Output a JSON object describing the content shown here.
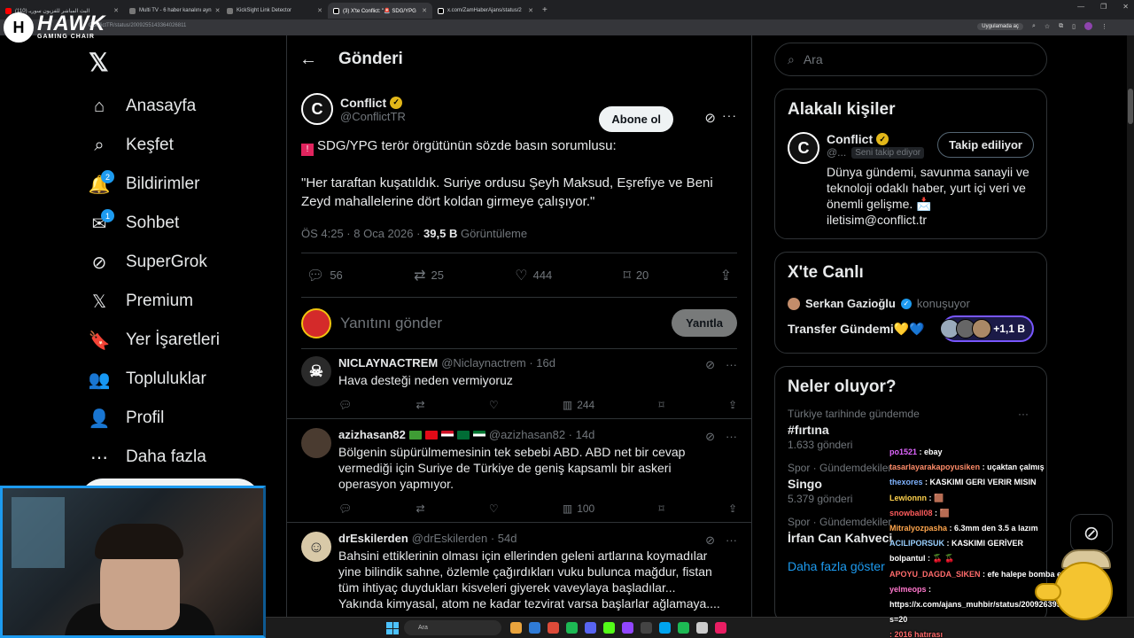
{
  "browser": {
    "tabs": [
      {
        "label": "(110) البث المباشر للفزيون سوريـ"
      },
      {
        "label": "Multi TV - 6 haber kanalını ayn"
      },
      {
        "label": "KickSight Link Detector"
      },
      {
        "label": "(3) X'te Conflict: \"🚨 SDG/YPG"
      },
      {
        "label": "x.com/ZamHaberAjans/status/2"
      }
    ],
    "url": "ConflictTR/status/2009255143364026811",
    "app_button": "Uygulamada aç"
  },
  "hawk": {
    "name": "HAWK",
    "sub": "GAMING CHAIR"
  },
  "nav": {
    "items": [
      {
        "label": "Anasayfa",
        "icon": "home-icon",
        "glyph": "⌂"
      },
      {
        "label": "Keşfet",
        "icon": "search-icon",
        "glyph": "⌕"
      },
      {
        "label": "Bildirimler",
        "icon": "bell-icon",
        "glyph": "🔔",
        "badge": "2"
      },
      {
        "label": "Sohbet",
        "icon": "mail-icon",
        "glyph": "✉",
        "badge": "1"
      },
      {
        "label": "SuperGrok",
        "icon": "grok-icon",
        "glyph": "⊘"
      },
      {
        "label": "Premium",
        "icon": "x-icon",
        "glyph": "𝕏"
      },
      {
        "label": "Yer İşaretleri",
        "icon": "bookmark-icon",
        "glyph": "🔖"
      },
      {
        "label": "Topluluklar",
        "icon": "communities-icon",
        "glyph": "👥"
      },
      {
        "label": "Profil",
        "icon": "profile-icon",
        "glyph": "👤"
      },
      {
        "label": "Daha fazla",
        "icon": "more-circle-icon",
        "glyph": "⋯"
      }
    ]
  },
  "main": {
    "title": "Gönderi",
    "tweet": {
      "name": "Conflict",
      "handle": "@ConflictTR",
      "subscribe": "Abone ol",
      "line1": "SDG/YPG terör örgütünün sözde basın sorumlusu:",
      "line2": "\"Her taraftan kuşatıldık. Suriye ordusu Şeyh Maksud, Eşrefiye ve Beni Zeyd mahallelerine dört koldan girmeye çalışıyor.\"",
      "time": "ÖS 4:25 · 8 Oca 2026 · ",
      "views": "39,5 B",
      "views_label": " Görüntüleme",
      "replies": "56",
      "reposts": "25",
      "likes": "444",
      "bookmarks": "20"
    },
    "reply_placeholder": "Yanıtını gönder",
    "reply_button": "Yanıtla",
    "replies": [
      {
        "name": "NICLAYNACTREM",
        "handle": "@Niclaynactrem · 16d",
        "text": "Hava desteği neden vermiyoruz",
        "views": "244"
      },
      {
        "name": "azizhasan82",
        "handle": "@azizhasan82 · 14d",
        "text": "Bölgenin süpürülmemesinin tek sebebi ABD. ABD net bir cevap vermediği için Suriye de Türkiye de geniş kapsamlı bir askeri operasyon yapmıyor.",
        "views": "100"
      },
      {
        "name": "drEskilerden",
        "handle": "@drEskilerden · 54d",
        "text": "Bahsini ettiklerinin olması için ellerinden geleni artlarına koymadılar yine bilindik sahne, özlemle çağırdıkları vuku bulunca mağdur, fistan tüm ihtiyaç duydukları kisveleri giyerek vaveylaya başladılar... Yakında kimyasal, atom ne kadar tezvirat varsa başlarlar ağlamaya...."
      }
    ]
  },
  "right": {
    "search_placeholder": "Ara",
    "related_title": "Alakalı kişiler",
    "person": {
      "name": "Conflict",
      "handle": "@...",
      "follows_you": "Seni takip ediyor",
      "follow_button": "Takip ediliyor",
      "bio": "Dünya gündemi, savunma sanayii ve teknoloji odaklı haber, yurt içi veri ve önemli gelişme. 📩 iletisim@conflict.tr"
    },
    "live_title": "X'te Canlı",
    "live": {
      "host": "Serkan Gazioğlu",
      "status": "konuşuyor",
      "topic": "Transfer Gündemi💛💙",
      "count": "+1,1 B"
    },
    "trends_title": "Neler oluyor?",
    "trends": [
      {
        "cat": "Türkiye tarihinde gündemde",
        "name": "#fırtına",
        "count": "1.633 gönderi"
      },
      {
        "cat": "Spor · Gündemdekiler",
        "name": "Singo",
        "count": "5.379 gönderi"
      },
      {
        "cat": "Spor · Gündemdekiler",
        "name": "İrfan Can Kahveci",
        "count": ""
      }
    ],
    "show_more": "Daha fazla göster"
  },
  "chat": [
    {
      "user": "po1521",
      "msg": " : ebay",
      "color": "#e066ff"
    },
    {
      "user": "tasarlayarakapoyusiken",
      "msg": " : uçaktan çalmış",
      "color": "#ff8c69"
    },
    {
      "user": "thexores",
      "msg": " : KASKIMI GERI VERIR MISIN",
      "color": "#7fb3ff"
    },
    {
      "user": "Lewionnn",
      "msg": " : 🟫",
      "color": "#ffd24d"
    },
    {
      "user": "snowball08",
      "msg": " : 🟫",
      "color": "#ff5c5c"
    },
    {
      "user": "Mitralyozpasha",
      "msg": " : 6.3mm den 3.5 a lazım",
      "color": "#ffa64d"
    },
    {
      "user": "ACILIPORSUK",
      "msg": " : KASKIMI GERİVER",
      "color": "#9ad0ff"
    },
    {
      "user": "bolpantul",
      "msg": " : 🍒 🍒",
      "color": "#ffffff"
    },
    {
      "user": "APOYU_DAGDA_SIKEN",
      "msg": " : efe halepe bomba ebecilirmi",
      "color": "#ff6b6b"
    },
    {
      "user": "yelmeops",
      "msg": " :",
      "color": "#ff77cc"
    },
    {
      "user": "",
      "msg": "https://x.com/ajans_muhbir/status/2009263991734841654?",
      "color": "#ffffff"
    },
    {
      "user": "",
      "msg": "s=20",
      "color": "#ffffff"
    },
    {
      "user": "",
      "msg": ": 2016 hatırası",
      "color": "#ff6b6b"
    }
  ],
  "taskbar": {
    "search": "Ara"
  }
}
